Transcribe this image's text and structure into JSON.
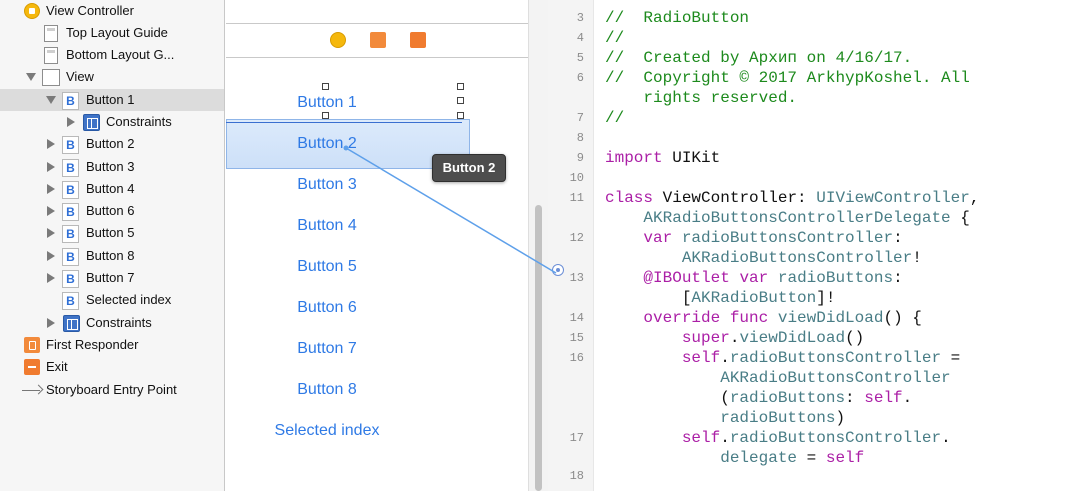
{
  "outline": {
    "items": [
      {
        "label": "View Controller",
        "icon": "view-controller-icon"
      },
      {
        "label": "Top Layout Guide",
        "icon": "layout-guide-icon"
      },
      {
        "label": "Bottom Layout G...",
        "icon": "layout-guide-icon"
      },
      {
        "label": "View",
        "icon": "view-icon"
      },
      {
        "label": "Button 1",
        "icon": "button-icon",
        "selected": true
      },
      {
        "label": "Constraints",
        "icon": "constraints-icon"
      },
      {
        "label": "Button 2",
        "icon": "button-icon"
      },
      {
        "label": "Button 3",
        "icon": "button-icon"
      },
      {
        "label": "Button 4",
        "icon": "button-icon"
      },
      {
        "label": "Button 6",
        "icon": "button-icon"
      },
      {
        "label": "Button 5",
        "icon": "button-icon"
      },
      {
        "label": "Button 8",
        "icon": "button-icon"
      },
      {
        "label": "Button 7",
        "icon": "button-icon"
      },
      {
        "label": "Selected index",
        "icon": "button-icon"
      },
      {
        "label": "Constraints",
        "icon": "constraints-icon"
      },
      {
        "label": "First Responder",
        "icon": "first-responder-icon"
      },
      {
        "label": "Exit",
        "icon": "exit-icon"
      },
      {
        "label": "Storyboard Entry Point",
        "icon": "entry-point-arrow-icon"
      }
    ],
    "button_glyph": "B"
  },
  "canvas": {
    "buttons": [
      "Button 1",
      "Button 2",
      "Button 3",
      "Button 4",
      "Button 5",
      "Button 6",
      "Button 7",
      "Button 8",
      "Selected index"
    ],
    "selected_button": "Button 2",
    "tooltip": "Button 2",
    "accent": "#2f7ae5"
  },
  "editor": {
    "line_numbers": [
      "3",
      "4",
      "5",
      "6",
      "7",
      "8",
      "9",
      "10",
      "11",
      "12",
      "13",
      "14",
      "15",
      "16",
      "17",
      "18"
    ],
    "lines": [
      "//  RadioButton",
      "//",
      "//  Created by Архип on 4/16/17.",
      "//  Copyright © 2017 ArkhypKoshel. All",
      "    rights reserved.",
      "//",
      "import UIKit",
      "class ViewController: UIViewController,",
      "    AKRadioButtonsControllerDelegate {",
      "    var radioButtonsController:",
      "        AKRadioButtonsController!",
      "    @IBOutlet var radioButtons:",
      "        [AKRadioButton]!",
      "    override func viewDidLoad() {",
      "        super.viewDidLoad()",
      "        self.radioButtonsController =",
      "            AKRadioButtonsController",
      "            (radioButtons: self.",
      "            radioButtons)",
      "        self.radioButtonsController.",
      "            delegate = self"
    ]
  }
}
